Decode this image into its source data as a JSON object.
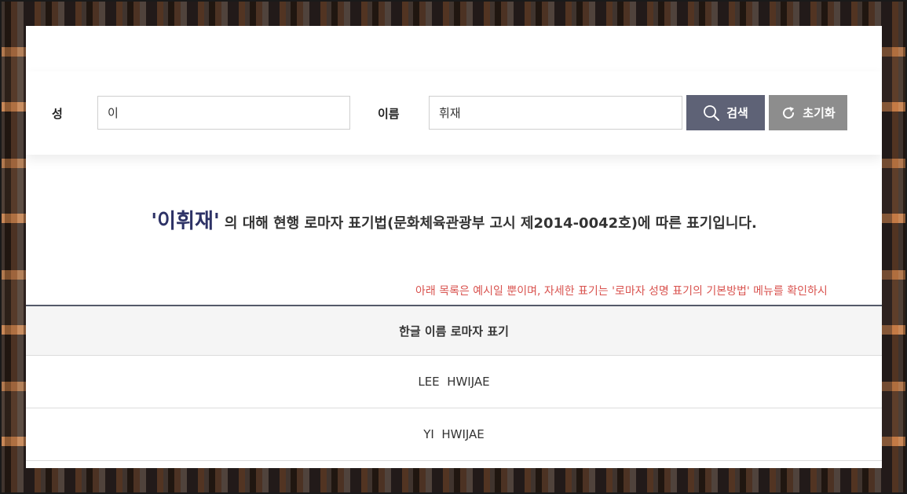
{
  "search": {
    "surname_label": "성",
    "surname_value": "이",
    "name_label": "이름",
    "name_value": "휘재",
    "search_button": "검색",
    "reset_button": "초기화"
  },
  "result": {
    "highlight_name": "'이휘재'",
    "headline_text": "의 대해 현행 로마자 표기법(문화체육관광부 고시 제2014-0042호)에 따른 표기입니다.",
    "notice": "아래 목록은 예시일 뿐이며, 자세한 표기는 '로마자 성명 표기의 기본방법' 메뉴를 확인하시"
  },
  "table": {
    "header": "한글 이름 로마자 표기",
    "rows": [
      "LEE  HWIJAE",
      "YI  HWIJAE"
    ]
  },
  "colors": {
    "search_button": "#5e6276",
    "reset_button": "#8d8d8d",
    "highlight": "#2d3266",
    "notice": "#d9534f"
  },
  "icons": {
    "search": "search-icon",
    "reset": "refresh-icon"
  }
}
